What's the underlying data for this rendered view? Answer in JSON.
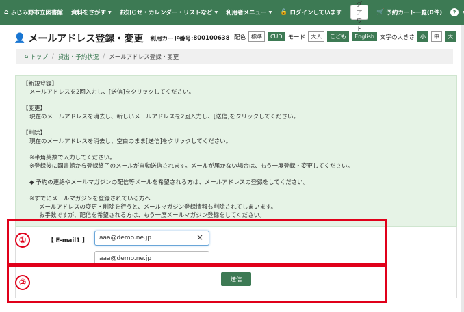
{
  "nav": {
    "items": [
      {
        "label": "ふじみ野市立図書館",
        "icon": "home-icon",
        "caret": false
      },
      {
        "label": "資料をさがす",
        "caret": true
      },
      {
        "label": "お知らせ・カレンダー・リストなど",
        "caret": true
      },
      {
        "label": "利用者メニュー",
        "caret": true
      },
      {
        "label": "ログインしています",
        "icon": "lock-icon",
        "caret": false
      }
    ],
    "logout_label": "ログアウト",
    "cart_label": "予約カート一覧(0件)",
    "help_label": "?"
  },
  "header": {
    "title": "メールアドレス登録・変更",
    "card_label": "利用カード番号:",
    "card_no": "800100638",
    "color_label": "配色",
    "color_standard": "標準",
    "cud_label": "CUD",
    "mode_label": "モード",
    "adult_label": "大人",
    "kids_label": "こども",
    "english_label": "English",
    "text_size_label": "文字の大きさ",
    "size_small": "小",
    "size_medium": "中",
    "size_large": "大"
  },
  "breadcrumb": {
    "home": "トップ",
    "lending": "貸出・予約状況",
    "current": "メールアドレス登録・変更"
  },
  "info": {
    "new_title": "【新規登録】",
    "new_text": "メールアドレスを2回入力し、[送信]をクリックしてください。",
    "change_title": "【変更】",
    "change_text": "現在のメールアドレスを消去し、新しいメールアドレスを2回入力し、[送信]をクリックしてください。",
    "delete_title": "【削除】",
    "delete_text": "現在のメールアドレスを消去し、空白のまま[送信]をクリックしてください。",
    "note1": "※半角英数で入力してください。",
    "note2": "※登録後に図書館から登録終了のメールが自動送信されます。メールが届かない場合は、もう一度登録・変更してください。",
    "note3": "◆ 予約の連絡やメールマガジンの配信等メールを希望される方は、メールアドレスの登録をしてください。",
    "note4": "※すでにメールマガジンを登録されている方へ",
    "note5": "メールアドレスの変更・削除を行うと、メールマガジン登録情報も削除されてしまいます。",
    "note6": "お手数ですが、配信を希望される方は、もう一度メールマガジン登録をしてください。"
  },
  "form": {
    "email_label": "【 E-mail1 】",
    "email_value": "aaa@demo.ne.jp",
    "email_confirm_value": "aaa@demo.ne.jp",
    "clear_label": "×",
    "submit_label": "送信"
  },
  "annotations": {
    "one": "①",
    "two": "②"
  },
  "colors": {
    "brand_green": "#3d7a54",
    "info_bg": "#e6f3e6",
    "annotation_red": "#e0001a"
  }
}
